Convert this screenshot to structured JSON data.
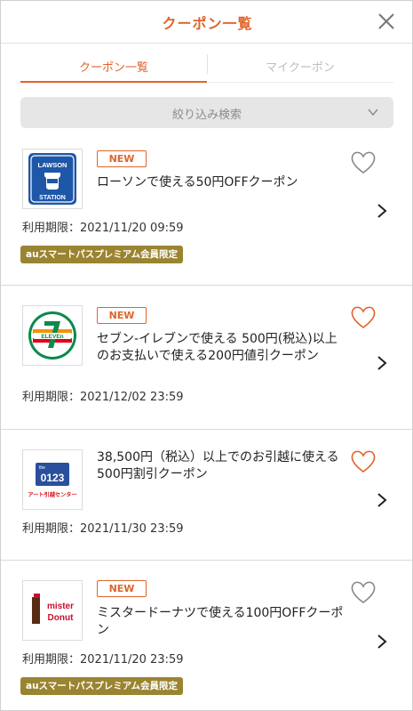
{
  "header": {
    "title": "クーポン一覧",
    "close_icon": "close-icon"
  },
  "tabs": [
    {
      "label": "クーポン一覧",
      "active": true
    },
    {
      "label": "マイクーポン",
      "active": false
    }
  ],
  "filter": {
    "label": "絞り込み検索",
    "icon": "chevron-down-icon"
  },
  "colors": {
    "accent": "#e0642a",
    "premium_badge": "#9a8431",
    "filter_bg": "#e6e6e6"
  },
  "coupons": [
    {
      "store_logo": "lawson-logo",
      "logo_text_top": "LAWSON",
      "logo_text_bottom": "STATION",
      "new_label": "NEW",
      "title": "ローソンで使える50円OFFクーポン",
      "expiry": "利用期限：2021/11/20 09:59",
      "premium_label": "auスマートパスプレミアム会員限定",
      "favorite": false
    },
    {
      "store_logo": "seven-eleven-logo",
      "logo_text": "ELEVEn",
      "new_label": "NEW",
      "title": "セブン-イレブンで使える 500円(税込)以上のお支払いで使える200円値引クーポン",
      "expiry": "利用期限：2021/12/02 23:59",
      "favorite": false
    },
    {
      "store_logo": "art-hikkoshi-logo",
      "logo_text_small": "the",
      "logo_text_number": "0123",
      "logo_text_bottom": "アート引越センター",
      "title": "38,500円（税込）以上でのお引越に使える500円割引クーポン",
      "expiry": "利用期限：2021/11/30 23:59",
      "favorite": false
    },
    {
      "store_logo": "mister-donut-logo",
      "logo_text_top": "mister",
      "logo_text_bottom": "Donut",
      "new_label": "NEW",
      "title": "ミスタードーナツで使える100円OFFクーポン",
      "expiry": "利用期限：2021/11/20 23:59",
      "premium_label": "auスマートパスプレミアム会員限定",
      "favorite": false
    }
  ]
}
